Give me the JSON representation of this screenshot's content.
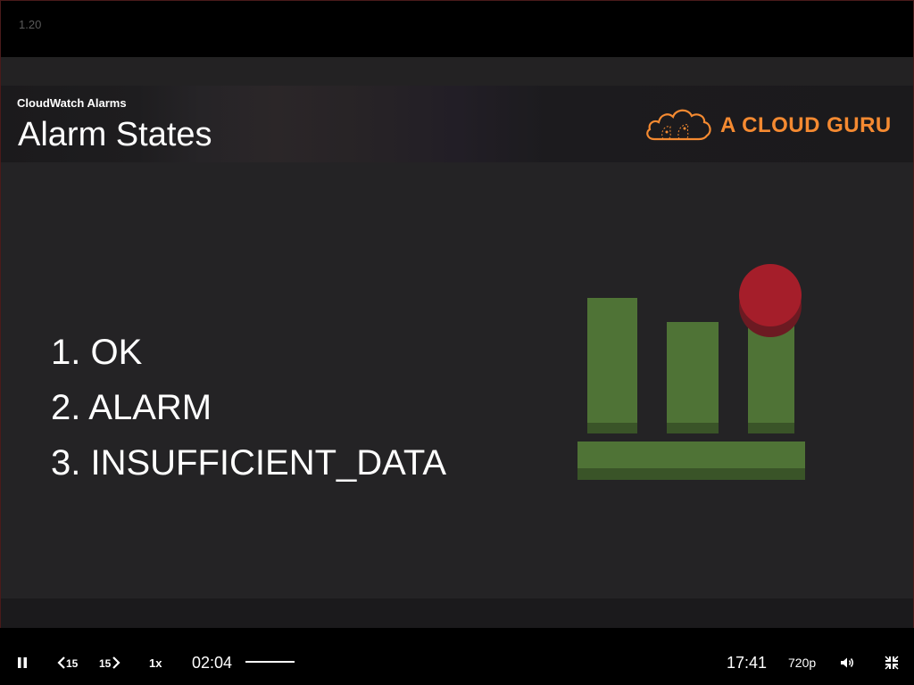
{
  "player": {
    "lesson_number": "1.20",
    "controls": {
      "play_pause_icon": "pause-icon",
      "rewind_label": "15",
      "forward_label": "15",
      "speed_label": "1x",
      "current_time": "02:04",
      "total_time": "17:41",
      "quality_label": "720p",
      "volume_icon": "volume-icon",
      "fullscreen_icon": "exit-fullscreen-icon"
    }
  },
  "slide": {
    "section": "CloudWatch Alarms",
    "title": "Alarm States",
    "brand": "A CLOUD GURU",
    "states": [
      "1. OK",
      "2. ALARM",
      "3. INSUFFICIENT_DATA"
    ],
    "colors": {
      "brand_orange": "#f58a31",
      "bar_green": "#4f7336",
      "alarm_red": "#a51e2a",
      "background": "#242325"
    }
  }
}
